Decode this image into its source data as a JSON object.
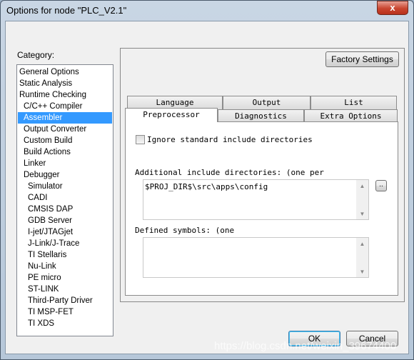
{
  "window": {
    "title": "Options for node \"PLC_V2.1\"",
    "close_label": "x"
  },
  "category": {
    "label": "Category:",
    "items": [
      {
        "label": "General Options",
        "level": 0
      },
      {
        "label": "Static Analysis",
        "level": 0
      },
      {
        "label": "Runtime Checking",
        "level": 0
      },
      {
        "label": "C/C++ Compiler",
        "level": 1
      },
      {
        "label": "Assembler",
        "level": 1,
        "selected": true
      },
      {
        "label": "Output Converter",
        "level": 1
      },
      {
        "label": "Custom Build",
        "level": 1
      },
      {
        "label": "Build Actions",
        "level": 1
      },
      {
        "label": "Linker",
        "level": 1
      },
      {
        "label": "Debugger",
        "level": 1
      },
      {
        "label": "Simulator",
        "level": 2
      },
      {
        "label": "CADI",
        "level": 2
      },
      {
        "label": "CMSIS DAP",
        "level": 2
      },
      {
        "label": "GDB Server",
        "level": 2
      },
      {
        "label": "I-jet/JTAGjet",
        "level": 2
      },
      {
        "label": "J-Link/J-Trace",
        "level": 2
      },
      {
        "label": "TI Stellaris",
        "level": 2
      },
      {
        "label": "Nu-Link",
        "level": 2
      },
      {
        "label": "PE micro",
        "level": 2
      },
      {
        "label": "ST-LINK",
        "level": 2
      },
      {
        "label": "Third-Party Driver",
        "level": 2
      },
      {
        "label": "TI MSP-FET",
        "level": 2
      },
      {
        "label": "TI XDS",
        "level": 2
      }
    ]
  },
  "factory_settings": "Factory Settings",
  "tabs": {
    "row1": [
      "Language",
      "Output",
      "List"
    ],
    "row2": [
      "Preprocessor",
      "Diagnostics",
      "Extra Options"
    ],
    "active": "Preprocessor"
  },
  "preprocessor": {
    "ignore_std_label": "Ignore standard include directories",
    "ignore_std_checked": false,
    "include_label": "Additional include directories:  (one per",
    "include_value": "$PROJ_DIR$\\src\\apps\\config",
    "browse_label": "..",
    "defined_label": "Defined symbols:  (one",
    "defined_value": ""
  },
  "buttons": {
    "ok": "OK",
    "cancel": "Cancel"
  },
  "watermark": "https://blog.csdn.net/weixin_39674400"
}
